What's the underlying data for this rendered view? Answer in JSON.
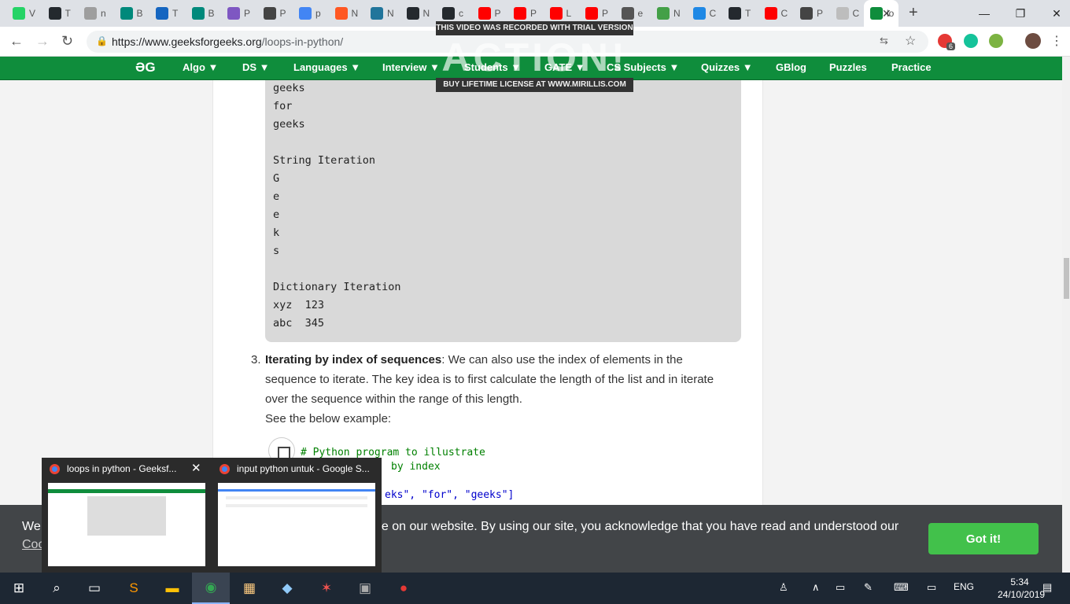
{
  "browser": {
    "tabs": [
      {
        "label": "V",
        "color": "#25d366"
      },
      {
        "label": "T",
        "color": "#24292e"
      },
      {
        "label": "n",
        "color": "#9e9e9e"
      },
      {
        "label": "B",
        "color": "#00897b"
      },
      {
        "label": "T",
        "color": "#1565c0"
      },
      {
        "label": "B",
        "color": "#00897b"
      },
      {
        "label": "P",
        "color": "#7e57c2"
      },
      {
        "label": "P",
        "color": "#444444"
      },
      {
        "label": "p",
        "color": "#4285f4"
      },
      {
        "label": "N",
        "color": "#ff5722"
      },
      {
        "label": "N",
        "color": "#21759b"
      },
      {
        "label": "N",
        "color": "#24292e"
      },
      {
        "label": "c",
        "color": "#24292e"
      },
      {
        "label": "P",
        "color": "#ff0000"
      },
      {
        "label": "P",
        "color": "#ff0000"
      },
      {
        "label": "L",
        "color": "#ff0000"
      },
      {
        "label": "P",
        "color": "#ff0000"
      },
      {
        "label": "e",
        "color": "#555555"
      },
      {
        "label": "N",
        "color": "#43a047"
      },
      {
        "label": "C",
        "color": "#1e88e5"
      },
      {
        "label": "T",
        "color": "#24292e"
      },
      {
        "label": "C",
        "color": "#ff0000"
      },
      {
        "label": "P",
        "color": "#444444"
      },
      {
        "label": "C",
        "color": "#bdbdbd"
      }
    ],
    "active_tab": {
      "label": "lo",
      "color": "#0f8d3c"
    },
    "url_host": "https://www.geeksforgeeks.org",
    "url_path": "/loops-in-python/",
    "ext_badge": "6"
  },
  "watermark": {
    "top": "THIS VIDEO WAS RECORDED WITH TRIAL VERSION",
    "logo": "ACTION!",
    "bottom": "BUY LIFETIME LICENSE AT WWW.MIRILLIS.COM"
  },
  "sitenav": {
    "logo": "ƏG",
    "items": [
      "Algo ▼",
      "DS ▼",
      "Languages ▼",
      "Interview ▼",
      "Students ▼",
      "GATE ▼",
      "CS Subjects ▼",
      "Quizzes ▼",
      "GBlog",
      "Puzzles",
      "Practice"
    ]
  },
  "output_lines": [
    "geeks",
    "for",
    "geeks",
    "",
    "String Iteration",
    "G",
    "e",
    "e",
    "k",
    "s",
    "",
    "Dictionary Iteration",
    "xyz  123",
    "abc  345"
  ],
  "article": {
    "item_number": "3.",
    "item_heading": "Iterating by index of sequences",
    "item_body": ": We can also use the index of elements in the sequence to iterate. The key idea is to first calculate the length of the list and in iterate over the sequence within the range of this length.",
    "see_below": "See the below example:",
    "code_comment1": "# Python program to illustrate",
    "code_comment2": "by index",
    "code_list": "eks\", \"for\", \"geeks\"]"
  },
  "cookie": {
    "text": "We use cookies to ensure you have the best browsing experience on our website. By using our site, you acknowledge that you have read and understood our",
    "link": "Cookie Policy",
    "button": "Got it!"
  },
  "previews": [
    {
      "title": "loops in python - Geeksf..."
    },
    {
      "title": "input python untuk - Google S..."
    }
  ],
  "taskbar": {
    "lang": "ENG",
    "time": "5:34",
    "date": "24/10/2019"
  }
}
